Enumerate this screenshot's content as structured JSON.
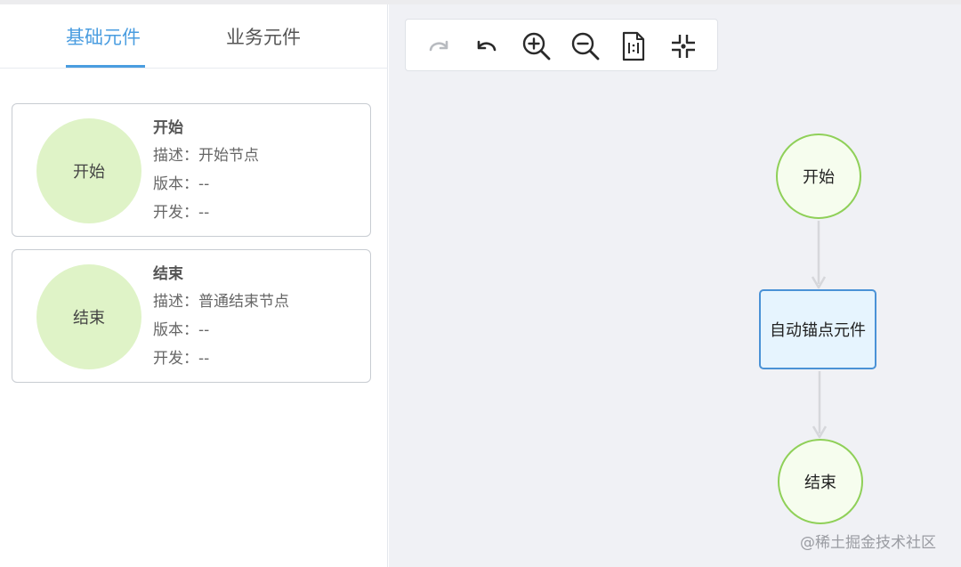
{
  "tabs": [
    {
      "label": "基础元件",
      "active": true
    },
    {
      "label": "业务元件",
      "active": false
    }
  ],
  "components": [
    {
      "circle_label": "开始",
      "title": "开始",
      "description": "描述：开始节点",
      "version": "版本：--",
      "developer": "开发：--"
    },
    {
      "circle_label": "结束",
      "title": "结束",
      "description": "描述：普通结束节点",
      "version": "版本：--",
      "developer": "开发：--"
    }
  ],
  "toolbar": {
    "icons": [
      "redo-icon",
      "undo-icon",
      "zoom-in-icon",
      "zoom-out-icon",
      "actual-size-icon",
      "fit-view-icon"
    ]
  },
  "flow": {
    "nodes": [
      {
        "id": "start",
        "label": "开始",
        "shape": "circle"
      },
      {
        "id": "anchor",
        "label": "自动锚点元件",
        "shape": "rect"
      },
      {
        "id": "end",
        "label": "结束",
        "shape": "circle"
      }
    ],
    "edges": [
      [
        "start",
        "anchor"
      ],
      [
        "anchor",
        "end"
      ]
    ]
  },
  "watermark": "@稀土掘金技术社区",
  "colors": {
    "accent": "#4a9de0",
    "circle_fill": "#dff3c7",
    "node_border_green": "#8fd058",
    "node_border_blue": "#4a92d6",
    "canvas_bg": "#f0f1f5"
  }
}
